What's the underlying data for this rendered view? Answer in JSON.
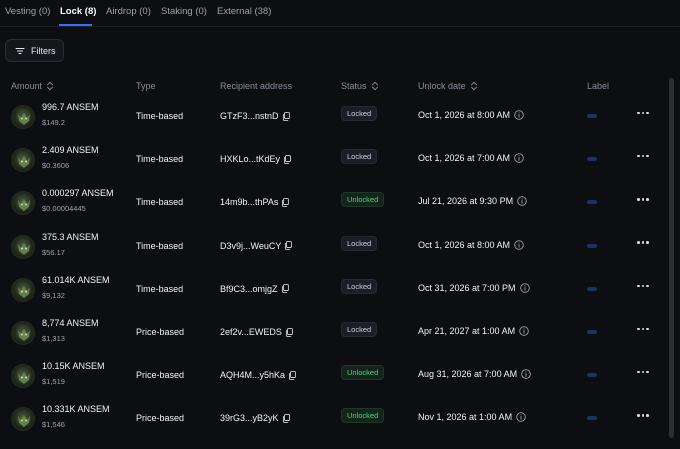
{
  "tabs": [
    {
      "label": "Vesting (0)",
      "active": false
    },
    {
      "label": "Lock (8)",
      "active": true
    },
    {
      "label": "Airdrop (0)",
      "active": false
    },
    {
      "label": "Staking (0)",
      "active": false
    },
    {
      "label": "External (38)",
      "active": false
    }
  ],
  "filters": {
    "label": "Filters"
  },
  "columns": {
    "amount": "Amount",
    "type": "Type",
    "recipient": "Recipient address",
    "status": "Status",
    "unlock_date": "Unlock date",
    "label": "Label"
  },
  "rows": [
    {
      "amount": "996.7 ANSEM",
      "usd": "$149.2",
      "type": "Time-based",
      "recipient": "GTzF3...nstnD",
      "status": "Locked",
      "unlock_date": "Oct 1, 2026 at 8:00 AM"
    },
    {
      "amount": "2.409 ANSEM",
      "usd": "$0.3606",
      "type": "Time-based",
      "recipient": "HXKLo...tKdEy",
      "status": "Locked",
      "unlock_date": "Oct 1, 2026 at 7:00 AM"
    },
    {
      "amount": "0.000297 ANSEM",
      "usd": "$0.00004445",
      "type": "Time-based",
      "recipient": "14m9b...thPAs",
      "status": "Unlocked",
      "unlock_date": "Jul 21, 2026 at 9:30 PM"
    },
    {
      "amount": "375.3 ANSEM",
      "usd": "$56.17",
      "type": "Time-based",
      "recipient": "D3v9j...WeuCY",
      "status": "Locked",
      "unlock_date": "Oct 1, 2026 at 8:00 AM"
    },
    {
      "amount": "61.014K ANSEM",
      "usd": "$9,132",
      "type": "Time-based",
      "recipient": "Bf9C3...omjgZ",
      "status": "Locked",
      "unlock_date": "Oct 31, 2026 at 7:00 PM"
    },
    {
      "amount": "8,774 ANSEM",
      "usd": "$1,313",
      "type": "Price-based",
      "recipient": "2ef2v...EWEDS",
      "status": "Locked",
      "unlock_date": "Apr 21, 2027 at 1:00 AM"
    },
    {
      "amount": "10.15K ANSEM",
      "usd": "$1,519",
      "type": "Price-based",
      "recipient": "AQH4M...y5hKa",
      "status": "Unlocked",
      "unlock_date": "Aug 31, 2026 at 7:00 AM"
    },
    {
      "amount": "10.331K ANSEM",
      "usd": "$1,546",
      "type": "Price-based",
      "recipient": "39rG3...yB2yK",
      "status": "Unlocked",
      "unlock_date": "Nov 1, 2026 at 1:00 AM"
    }
  ],
  "colors": {
    "background": "#0d0e12",
    "accent": "#3b6df6",
    "unlocked": "#4fd37a",
    "locked": "#cfd1d8"
  }
}
